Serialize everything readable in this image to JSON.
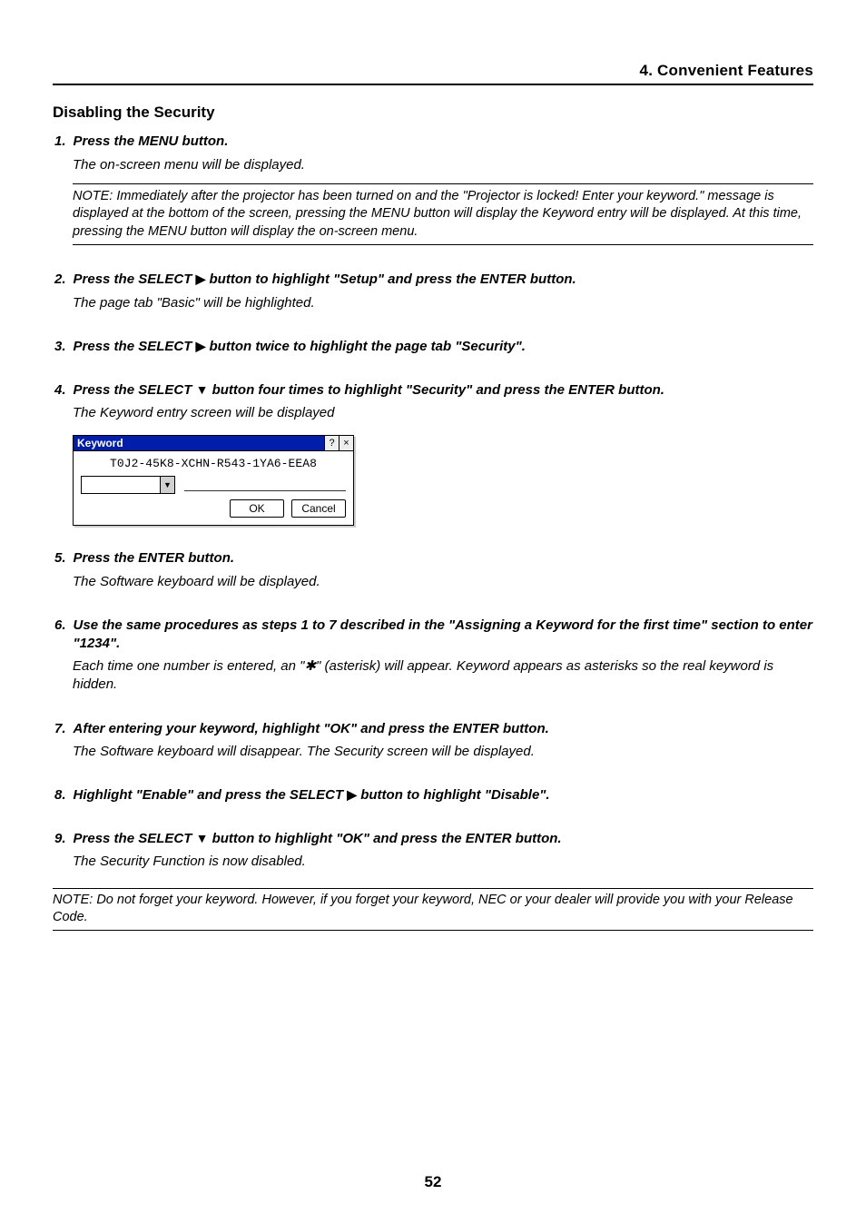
{
  "header": {
    "chapter": "4. Convenient Features"
  },
  "section": {
    "title": "Disabling the Security"
  },
  "steps": [
    {
      "num": "1.",
      "text": "Press the MENU button.",
      "desc": "The on-screen menu will be displayed.",
      "note": "NOTE: Immediately after the projector has been turned on and the \"Projector is locked! Enter your keyword.\" message is displayed at the bottom of the screen, pressing the MENU button will display the Keyword entry will be displayed. At this time, pressing the MENU button will display the on-screen menu."
    },
    {
      "num": "2.",
      "pre": "Press the SELECT ",
      "glyph": "▶",
      "post": " button to highlight \"Setup\" and press the ENTER button.",
      "desc": "The page tab \"Basic\" will be highlighted."
    },
    {
      "num": "3.",
      "pre": "Press the SELECT ",
      "glyph": "▶",
      "post": " button twice to highlight the page tab \"Security\"."
    },
    {
      "num": "4.",
      "pre": "Press the SELECT ",
      "glyph": "▼",
      "post": " button four times to highlight \"Security\" and press the ENTER button.",
      "desc": "The Keyword entry screen will be displayed"
    },
    {
      "num": "5.",
      "text": "Press the ENTER button.",
      "desc": "The Software keyboard will be displayed."
    },
    {
      "num": "6.",
      "text": "Use the same procedures as steps 1 to 7 described in the \"Assigning a Keyword for the first time\" section to enter \"1234\".",
      "desc": "Each time one number is entered, an \"✱\" (asterisk) will appear. Keyword appears as asterisks so the real keyword is hidden."
    },
    {
      "num": "7.",
      "text": "After entering your keyword, highlight \"OK\" and press the ENTER button.",
      "desc": "The Software keyboard will disappear. The Security screen will be displayed."
    },
    {
      "num": "8.",
      "pre": "Highlight \"Enable\" and press the SELECT ",
      "glyph": "▶",
      "post": " button to highlight \"Disable\"."
    },
    {
      "num": "9.",
      "pre": "Press the SELECT ",
      "glyph": "▼",
      "post": " button to highlight \"OK\" and press the ENTER button.",
      "desc": "The Security Function is now disabled."
    }
  ],
  "dialog": {
    "title": "Keyword",
    "help": "?",
    "close": "×",
    "code": "T0J2-45K8-XCHN-R543-1YA6-EEA8",
    "dropdown_glyph": "▼",
    "ok": "OK",
    "cancel": "Cancel"
  },
  "footnote": "NOTE: Do not forget your keyword. However, if you forget your keyword, NEC or your dealer will provide you with your Release Code.",
  "page_number": "52"
}
